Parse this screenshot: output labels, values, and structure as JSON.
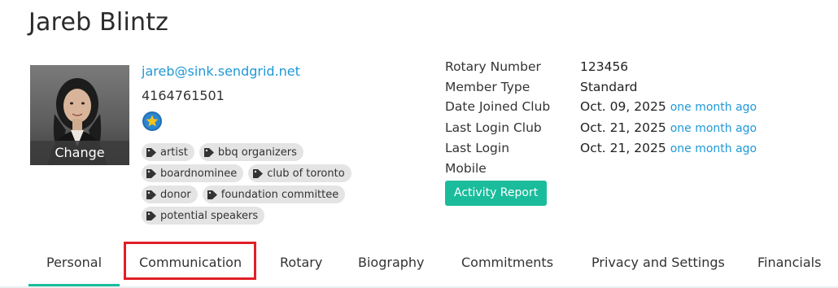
{
  "member": {
    "name": "Jareb Blintz",
    "email": "jareb@sink.sendgrid.net",
    "phone": "4164761501",
    "photo_action": "Change",
    "badge_icon": "star-badge-icon"
  },
  "tags": [
    "artist",
    "bbq organizers",
    "boardnominee",
    "club of toronto",
    "donor",
    "foundation committee",
    "potential speakers"
  ],
  "info": {
    "rotary_number_label": "Rotary Number",
    "rotary_number": "123456",
    "member_type_label": "Member Type",
    "member_type": "Standard",
    "date_joined_label": "Date Joined Club",
    "date_joined": "Oct. 09, 2025",
    "date_joined_ago": "one month ago",
    "last_login_club_label": "Last Login Club",
    "last_login_club": "Oct. 21, 2025",
    "last_login_club_ago": "one month ago",
    "last_login_mobile_label_1": "Last Login",
    "last_login_mobile_label_2": "Mobile",
    "last_login_mobile": "Oct. 21, 2025",
    "last_login_mobile_ago": "one month ago"
  },
  "activity_report_label": "Activity Report",
  "tabs": [
    "Personal",
    "Communication",
    "Rotary",
    "Biography",
    "Commitments",
    "Privacy and Settings",
    "Financials"
  ],
  "colors": {
    "accent": "#1abc9c",
    "link": "#1f98d6",
    "highlight": "#e11f26",
    "tag_bg": "#e4e4e4"
  }
}
